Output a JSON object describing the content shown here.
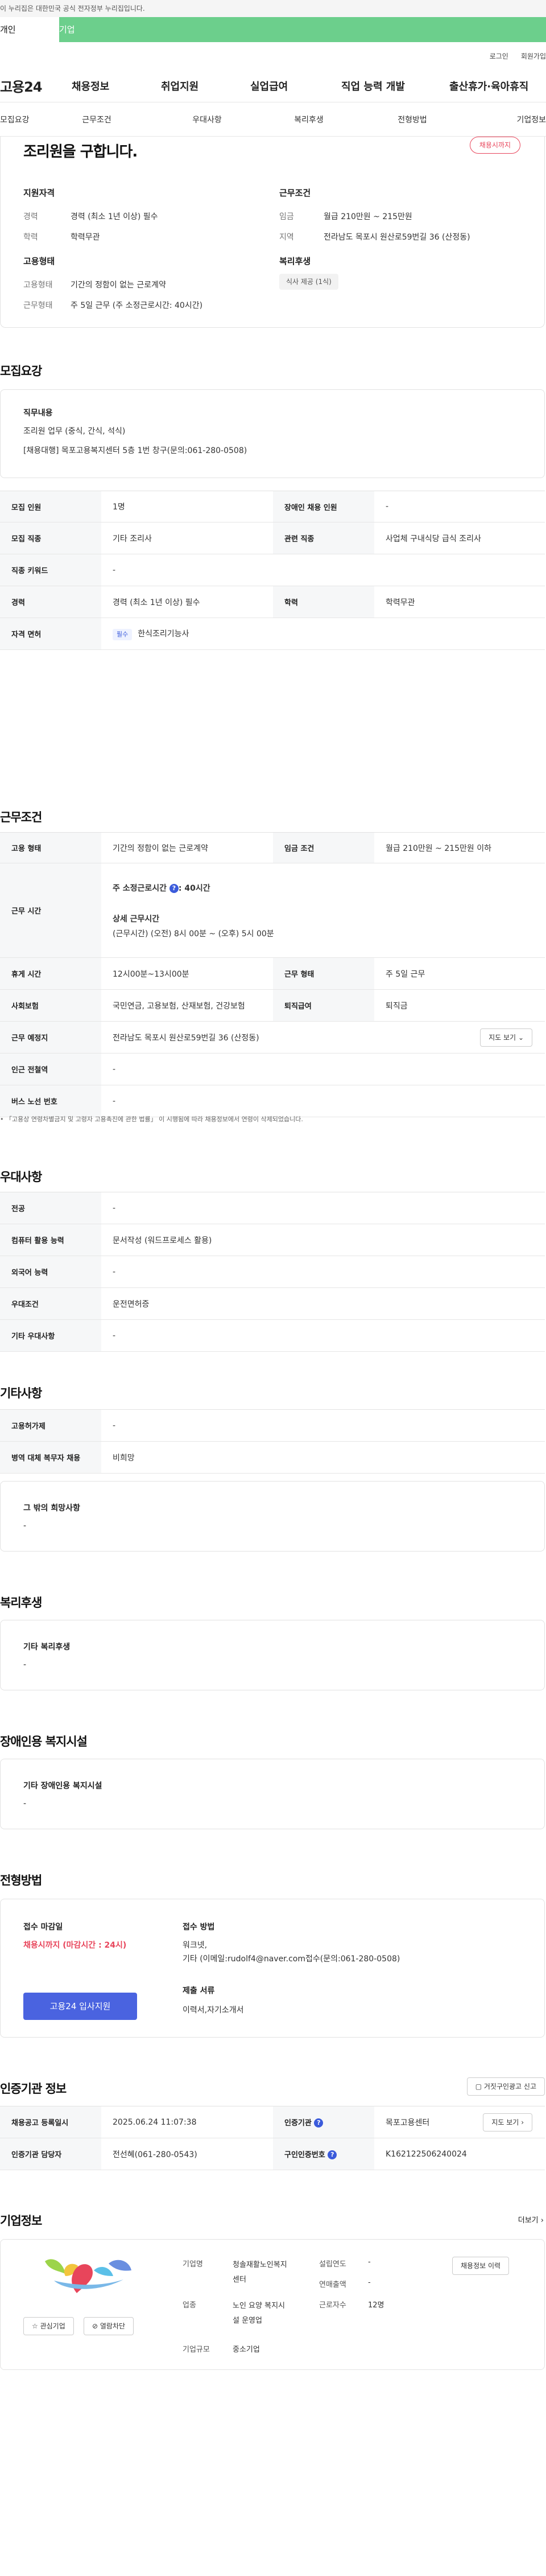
{
  "gov_notice": "이 누리집은 대한민국 공식 전자정부 누리집입니다.",
  "user_tabs": {
    "person": "개인",
    "business": "기업"
  },
  "util": {
    "login": "로그인",
    "join": "회원가입"
  },
  "logo": "고용24",
  "gnb": [
    "채용정보",
    "취업지원",
    "실업급여",
    "직업 능력 개발",
    "출산휴가·육아휴직"
  ],
  "subnav": [
    "모집요강",
    "근무조건",
    "우대사항",
    "복리후생",
    "전형방법",
    "기업정보"
  ],
  "summary": {
    "title": "조리원을 구합니다.",
    "status": "채용시까지",
    "qual_title": "지원자격",
    "qual": [
      {
        "k": "경력",
        "v": "경력 (최소 1년 이상) 필수"
      },
      {
        "k": "학력",
        "v": "학력무관"
      }
    ],
    "emp_title": "고용형태",
    "emp": [
      {
        "k": "고용형태",
        "v": "기간의 정함이 없는 근로계약"
      },
      {
        "k": "근무형태",
        "v": "주 5일 근무 (주 소정근로시간: 40시간)"
      }
    ],
    "cond_title": "근무조건",
    "cond": [
      {
        "k": "임금",
        "v": "월급 210만원 ~ 215만원"
      },
      {
        "k": "지역",
        "v": "전라남도 목포시 원산로59번길 36 (산정동)"
      }
    ],
    "welfare_title": "복리후생",
    "welfare_chip": "식사 제공 (1식)"
  },
  "recruit": {
    "title": "모집요강",
    "duty_title": "직무내용",
    "duty_lines": [
      "조리원 업무 (중식, 간식, 석식)",
      "[채용대행] 목포고용복지센터 5층 1번 창구(문의:061-280-0508)"
    ],
    "rows": [
      {
        "h1": "모집 인원",
        "v1": "1명",
        "h2": "장애인 채용 인원",
        "v2": "-"
      },
      {
        "h1": "모집 직종",
        "v1": "기타 조리사",
        "h2": "관련 직종",
        "v2": "사업체 구내식당 급식 조리사"
      },
      {
        "h1": "직종 키워드",
        "v1": "-"
      },
      {
        "h1": "경력",
        "v1": "경력 (최소 1년 이상) 필수",
        "h2": "학력",
        "v2": "학력무관"
      },
      {
        "h1": "자격 면허",
        "tag": "필수",
        "v1": "한식조리기능사"
      }
    ]
  },
  "work": {
    "title": "근무조건",
    "r1": {
      "h1": "고용 형태",
      "v1": "기간의 정함이 없는 근로계약",
      "h2": "임금 조건",
      "v2": "월급 210만원 ~ 215만원 이하"
    },
    "hours": {
      "h": "근무 시간",
      "weekly_label": "주 소정근로시간",
      "weekly_val": ": 40시간",
      "detail_label": "상세 근무시간",
      "detail_val": "(근무시간) (오전) 8시 00분 ~ (오후) 5시 00분"
    },
    "r3": {
      "h1": "휴게 시간",
      "v1": "12시00분~13시00분",
      "h2": "근무 형태",
      "v2": "주 5일 근무"
    },
    "r4": {
      "h1": "사회보험",
      "v1": "국민연금, 고용보험, 산재보험, 건강보험",
      "h2": "퇴직급여",
      "v2": "퇴직금"
    },
    "r5": {
      "h": "근무 예정지",
      "v": "전라남도 목포시 원산로59번길 36 (산정동)",
      "btn": "지도 보기"
    },
    "r6": {
      "h": "인근 전철역",
      "v": "-"
    },
    "r7": {
      "h": "버스 노선 번호",
      "v": "-"
    },
    "note": "「고용상 연령차별금지 및 고령자 고용촉진에 관한 법률」 이 시행됨에 따라 채용정보에서 연령이 삭제되었습니다."
  },
  "pref": {
    "title": "우대사항",
    "rows": [
      {
        "h": "전공",
        "v": "-"
      },
      {
        "h": "컴퓨터 활용 능력",
        "v": "문서작성 (워드프로세스 활용)"
      },
      {
        "h": "외국어 능력",
        "v": "-"
      },
      {
        "h": "우대조건",
        "v": "운전면허증"
      },
      {
        "h": "기타 우대사항",
        "v": "-"
      }
    ]
  },
  "etc": {
    "title": "기타사항",
    "rows": [
      {
        "h": "고용허가제",
        "v": "-"
      },
      {
        "h": "병역 대체 복무자 채용",
        "v": "비희망"
      }
    ],
    "box_title": "그 밖의 희망사항",
    "box_val": "-"
  },
  "welfare": {
    "title": "복리후생",
    "box_title": "기타 복리후생",
    "box_val": "-"
  },
  "disabled": {
    "title": "장애인용 복지시설",
    "box_title": "기타 장애인용 복지시설",
    "box_val": "-"
  },
  "apply": {
    "title": "전형방법",
    "deadline_label": "접수 마감일",
    "deadline_val": "채용시까지 (마감시간 : 24시)",
    "btn": "고용24 입사지원",
    "method_label": "접수 방법",
    "method_lines": [
      "워크넷,",
      "기타 (이메일:rudolf4@naver.com접수(문의:061-280-0508)"
    ],
    "docs_label": "제출 서류",
    "docs_val": "이력서,자기소개서"
  },
  "agency": {
    "title": "인증기관 정보",
    "report_btn": "거짓구인광고 신고",
    "r1": {
      "h1": "채용공고 등록일시",
      "v1": "2025.06.24 11:07:38",
      "h2": "인증기관",
      "v2": "목포고용센터",
      "btn": "지도 보기"
    },
    "r2": {
      "h1": "인증기관 담당자",
      "v1": "전선혜(061-280-0543)",
      "h2": "구인인증번호",
      "v2": "K162122506240024"
    }
  },
  "company": {
    "title": "기업정보",
    "more": "더보기",
    "fav_btn": "관심기업",
    "block_btn": "열람차단",
    "f1_label": "기업명",
    "f1_lines": [
      "청솔재활노인복지",
      "센터"
    ],
    "f2_label": "업종",
    "f2_lines": [
      "노인 요양 복지시",
      "설 운영업"
    ],
    "f3_label": "기업규모",
    "f3_val": "중소기업",
    "s1_label": "설립연도",
    "s1_val": "-",
    "s2_label": "연매출액",
    "s2_val": "-",
    "s3_label": "근로자수",
    "s3_val": "12명",
    "job_btn": "채용정보 이력"
  },
  "colors": {
    "accent_green": "#6ccf8c",
    "accent_red": "#e8455b",
    "accent_blue": "#4a63e0"
  }
}
